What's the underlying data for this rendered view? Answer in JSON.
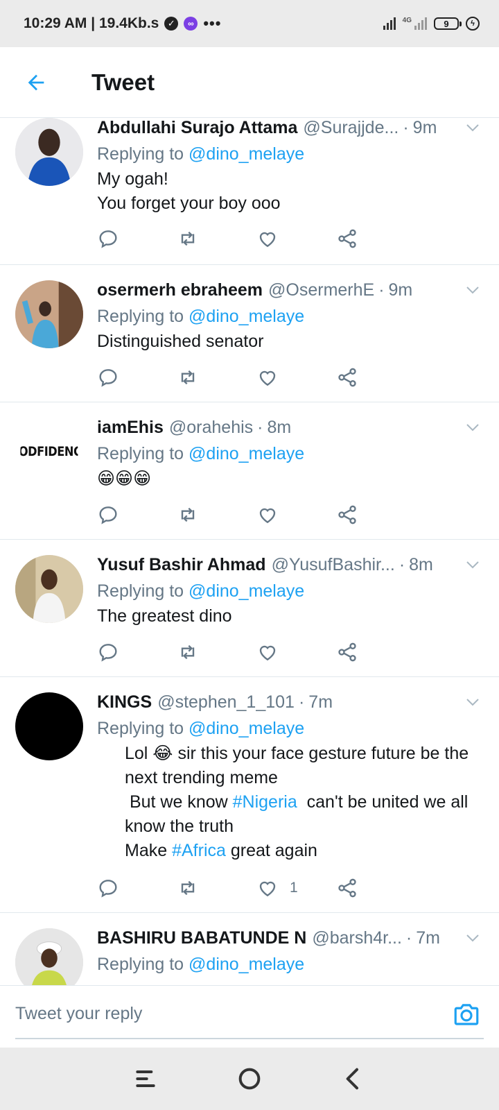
{
  "status_bar": {
    "time_speed": "10:29 AM | 19.4Kb.s",
    "network_label": "4G",
    "battery_level": "9"
  },
  "header": {
    "title": "Tweet"
  },
  "tweets": [
    {
      "name": "Abdullahi Surajo Attama",
      "handle": "@Surajjde...",
      "time": "9m",
      "replying_prefix": "Replying to",
      "replying_to": "@dino_melaye",
      "text": "My ogah!\nYou forget your boy ooo",
      "likes": ""
    },
    {
      "name": "osermerh ebraheem",
      "handle": "@OsermerhE",
      "time": "9m",
      "replying_prefix": "Replying to",
      "replying_to": "@dino_melaye",
      "text": "Distinguished senator",
      "likes": ""
    },
    {
      "name": "iamEhis",
      "handle": "@orahehis",
      "time": "8m",
      "avatar_text": "GODFIDENCE",
      "replying_prefix": "Replying to",
      "replying_to": "@dino_melaye",
      "text": "😁😁😁",
      "likes": ""
    },
    {
      "name": "Yusuf Bashir Ahmad",
      "handle": "@YusufBashir...",
      "time": "8m",
      "replying_prefix": "Replying to",
      "replying_to": "@dino_melaye",
      "text": "The greatest dino",
      "likes": ""
    },
    {
      "name": "KINGS",
      "handle": "@stephen_1_101",
      "time": "7m",
      "replying_prefix": "Replying to",
      "replying_to": "@dino_melaye",
      "text_parts": {
        "line1": "Lol 😂 sir this your face gesture future be the next trending meme",
        "line2a": " But we know ",
        "hashtag1": "#Nigeria",
        "line2b": "  can't be united we all know the truth",
        "line3a": "Make ",
        "hashtag2": "#Africa",
        "line3b": " great again"
      },
      "likes": "1"
    },
    {
      "name": "BASHIRU BABATUNDE N",
      "handle": "@barsh4r...",
      "time": "7m",
      "replying_prefix": "Replying to",
      "replying_to": "@dino_melaye"
    }
  ],
  "reply_bar": {
    "placeholder": "Tweet your reply"
  },
  "icons": {
    "back": "arrow-left-icon",
    "reply": "reply-icon",
    "retweet": "retweet-icon",
    "like": "heart-icon",
    "share": "share-icon",
    "caret": "chevron-down-icon",
    "camera": "camera-icon"
  },
  "colors": {
    "accent": "#1da1f2",
    "muted": "#657786",
    "text": "#14171a",
    "divider": "#e1e8ed"
  }
}
